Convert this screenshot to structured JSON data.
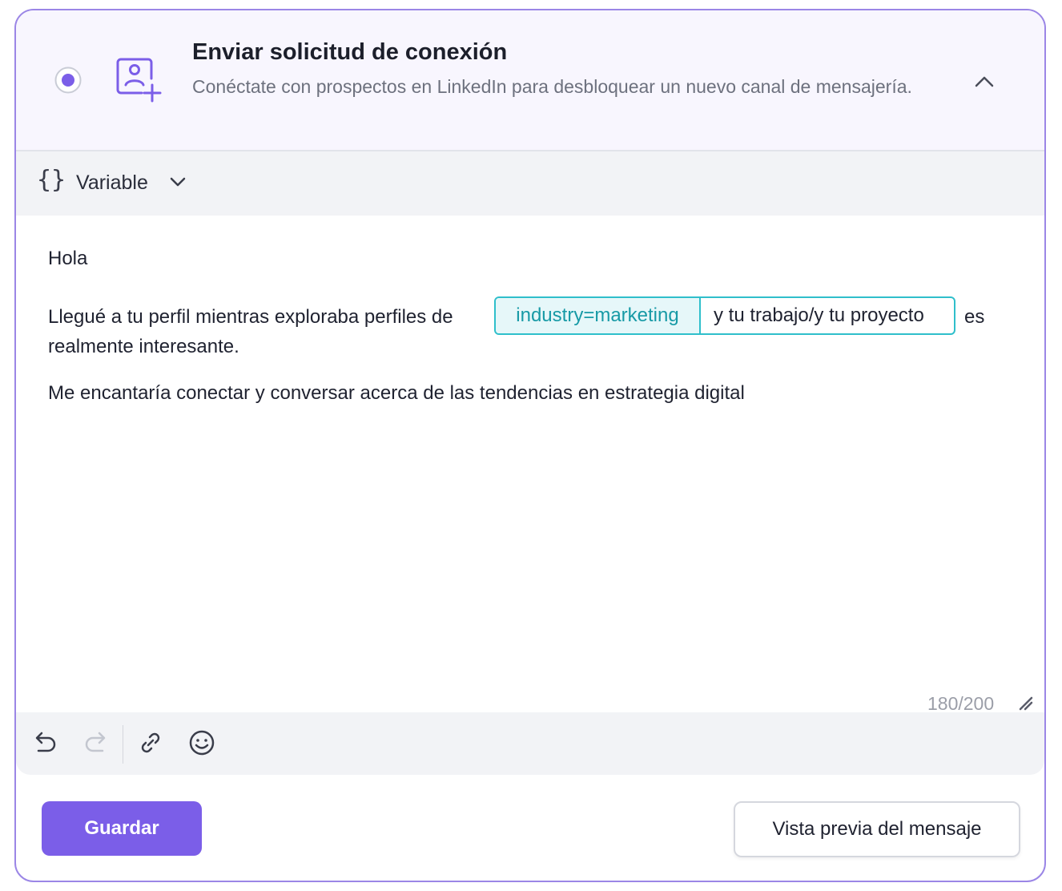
{
  "header": {
    "title": "Enviar solicitud de conexión",
    "description": "Conéctate con prospectos en LinkedIn para desbloquear un nuevo canal de mensajería.",
    "selected": true
  },
  "variable_bar": {
    "label": "Variable",
    "icon": "braces-icon"
  },
  "editor": {
    "p1": "Hola",
    "p2_before": "Llegué a tu perfil mientras exploraba perfiles de",
    "chip_variable": "industry=marketing",
    "chip_fallback": "y tu trabajo/y tu proyecto",
    "p2_after": "es",
    "p2_line2": "realmente interesante.",
    "p3": "Me encantaría conectar y conversar acerca de las tendencias en estrategia digital",
    "counter": "180/200"
  },
  "toolbar": {
    "icons": [
      "undo-icon",
      "redo-icon",
      "link-icon",
      "emoji-icon"
    ]
  },
  "actions": {
    "save_label": "Guardar",
    "preview_label": "Vista previa del mensaje"
  },
  "colors": {
    "accent": "#7b5ee8",
    "border": "#9b86e6",
    "chip": "#2fbfcb",
    "header_bg": "#f8f6fe"
  }
}
